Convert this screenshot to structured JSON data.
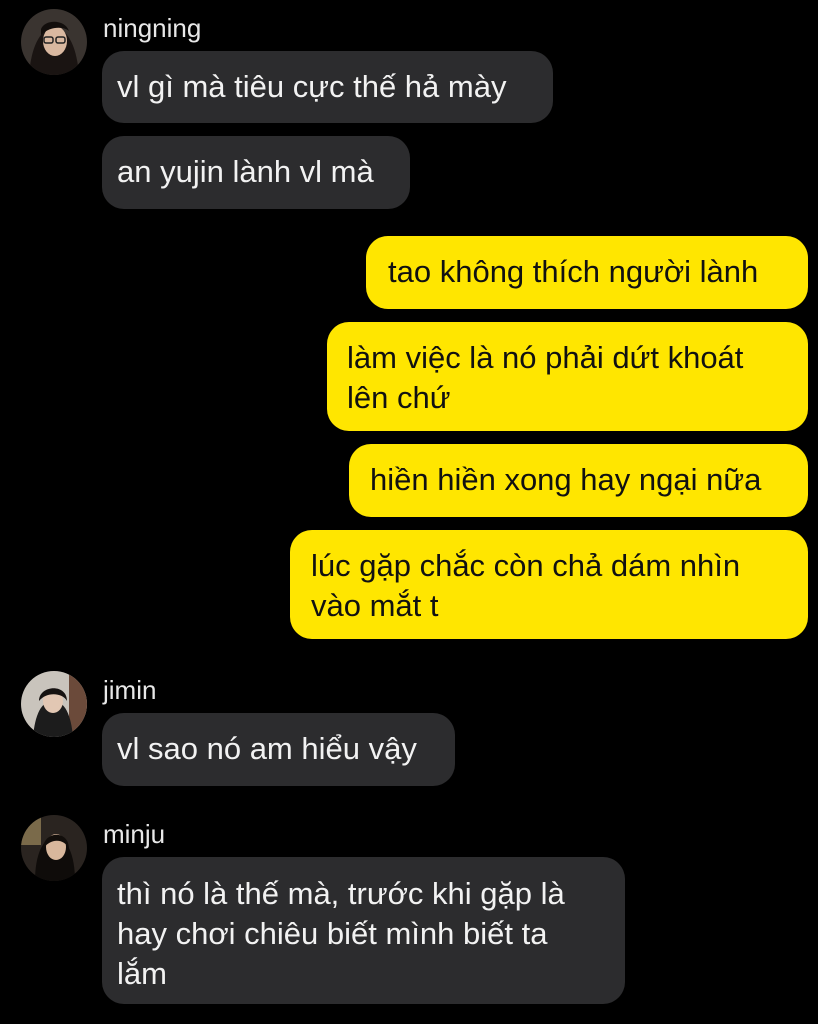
{
  "colors": {
    "background": "#000000",
    "incoming_bubble": "#2c2c2e",
    "outgoing_bubble": "#ffe600"
  },
  "messages": [
    {
      "sender": "ningning",
      "avatar": "avatar-photo-icon",
      "text": "vl gì mà tiêu cực thế hả mày"
    },
    {
      "text": "an yujin lành vl mà"
    },
    {
      "outgoing": true,
      "text": "tao không thích người lành"
    },
    {
      "outgoing": true,
      "text": "làm việc là nó phải dứt khoát\nlên chứ"
    },
    {
      "outgoing": true,
      "text": "hiền hiền xong hay ngại nữa"
    },
    {
      "outgoing": true,
      "text": "lúc gặp chắc còn chả dám nhìn\nvào mắt t"
    },
    {
      "sender": "jimin",
      "avatar": "avatar-photo-icon",
      "text": "vl sao nó am hiểu vậy"
    },
    {
      "sender": "minju",
      "avatar": "avatar-photo-icon",
      "text": "thì nó là thế mà, trước khi gặp là\nhay chơi chiêu biết mình biết ta\nlắm"
    }
  ]
}
